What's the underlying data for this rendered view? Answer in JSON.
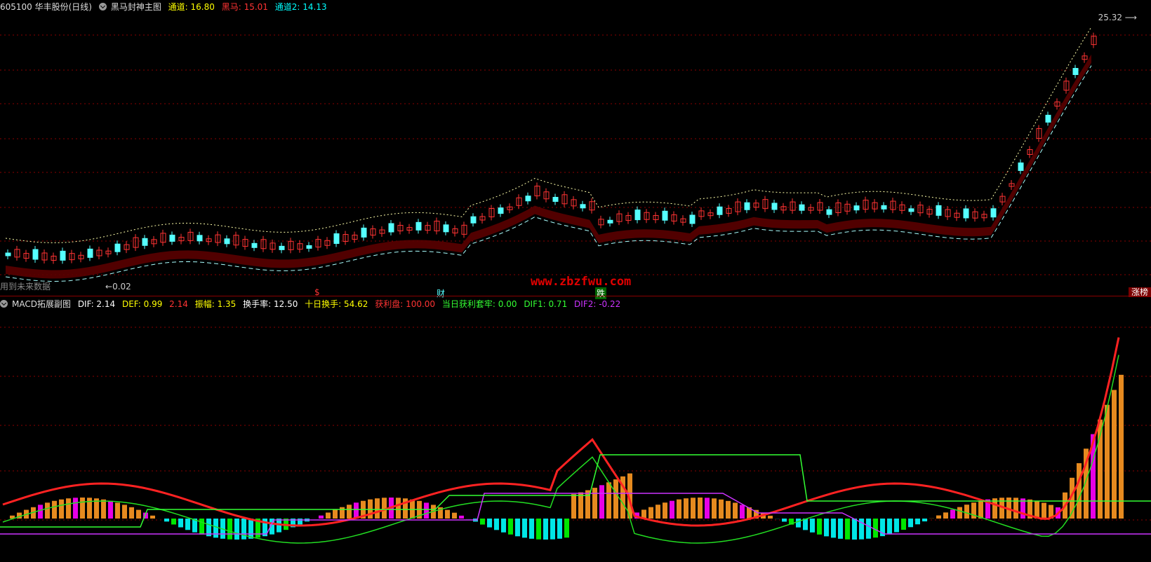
{
  "main_header": {
    "stock": "605100 华丰股份(日线)",
    "indicator": "黑马封神主图",
    "items": [
      {
        "label": "通道: 16.80",
        "color": "#ffff00"
      },
      {
        "label": "黑马: 15.01",
        "color": "#ff3333"
      },
      {
        "label": "通道2: 14.13",
        "color": "#00ffff"
      }
    ]
  },
  "price_label": "25.32",
  "note": "用到未来数据",
  "low_label": "0.02",
  "markers": {
    "s": "$",
    "cai": "财",
    "die": "跌"
  },
  "tag": "涨榜",
  "watermark": "www.zbzfwu.com",
  "sub_header": {
    "indicator": "MACD拓展副图",
    "items": [
      {
        "label": "DIF: 2.14",
        "color": "#ffffff"
      },
      {
        "label": "DEF: 0.99",
        "color": "#ffff00"
      },
      {
        "label": "2.14",
        "color": "#ff3333"
      },
      {
        "label": "振幅: 1.35",
        "color": "#ffff00"
      },
      {
        "label": "换手率: 12.50",
        "color": "#ffffff"
      },
      {
        "label": "十日换手: 54.62",
        "color": "#ffff00"
      },
      {
        "label": "获利盘: 100.00",
        "color": "#ff3333"
      },
      {
        "label": "当日获利套牢: 0.00",
        "color": "#33ff33"
      },
      {
        "label": "DIF1: 0.71",
        "color": "#33ff33"
      },
      {
        "label": "DIF2: -0.22",
        "color": "#cc33ff"
      }
    ]
  },
  "colors": {
    "up": "#ff3333",
    "down": "#55ffff",
    "band": "#5a0000",
    "grid": "#8b0000"
  }
}
